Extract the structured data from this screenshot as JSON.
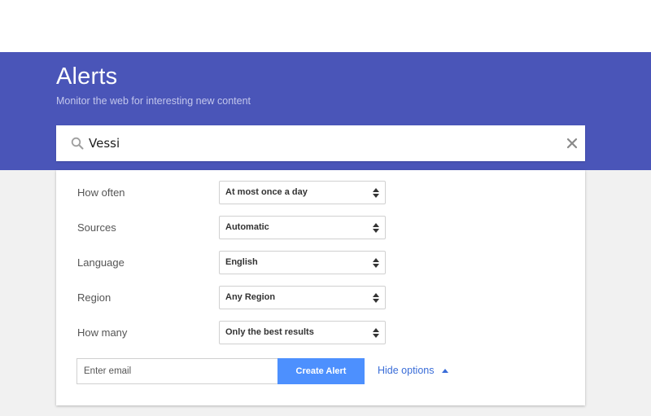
{
  "header": {
    "title": "Alerts",
    "subtitle": "Monitor the web for interesting new content"
  },
  "search": {
    "value": "Vessi",
    "icon": "search-icon",
    "clear_icon": "close-icon"
  },
  "options": [
    {
      "label": "How often",
      "value": "At most once a day"
    },
    {
      "label": "Sources",
      "value": "Automatic"
    },
    {
      "label": "Language",
      "value": "English"
    },
    {
      "label": "Region",
      "value": "Any Region"
    },
    {
      "label": "How many",
      "value": "Only the best results"
    }
  ],
  "email": {
    "placeholder": "Enter email",
    "value": ""
  },
  "create_button": "Create Alert",
  "hide_options": "Hide options",
  "colors": {
    "banner": "#4a55b8",
    "button": "#4d90fe",
    "link": "#3a6dd8"
  }
}
